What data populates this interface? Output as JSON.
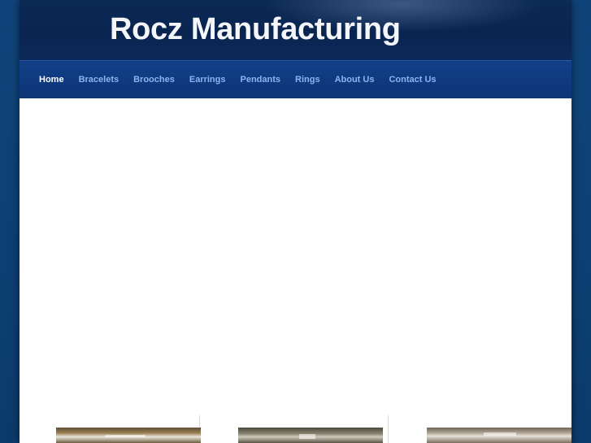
{
  "header": {
    "title": "Rocz Manufacturing"
  },
  "nav": {
    "items": [
      {
        "label": "Home",
        "active": true
      },
      {
        "label": "Bracelets",
        "active": false
      },
      {
        "label": "Brooches",
        "active": false
      },
      {
        "label": "Earrings",
        "active": false
      },
      {
        "label": "Pendants",
        "active": false
      },
      {
        "label": "Rings",
        "active": false
      },
      {
        "label": "About Us",
        "active": false
      },
      {
        "label": "Contact Us",
        "active": false
      }
    ]
  },
  "colors": {
    "background": "#114a83",
    "header": "#0a2450",
    "navbar": "#0f3a80",
    "nav_link": "#8ab4ef",
    "nav_active": "#ffffff"
  }
}
